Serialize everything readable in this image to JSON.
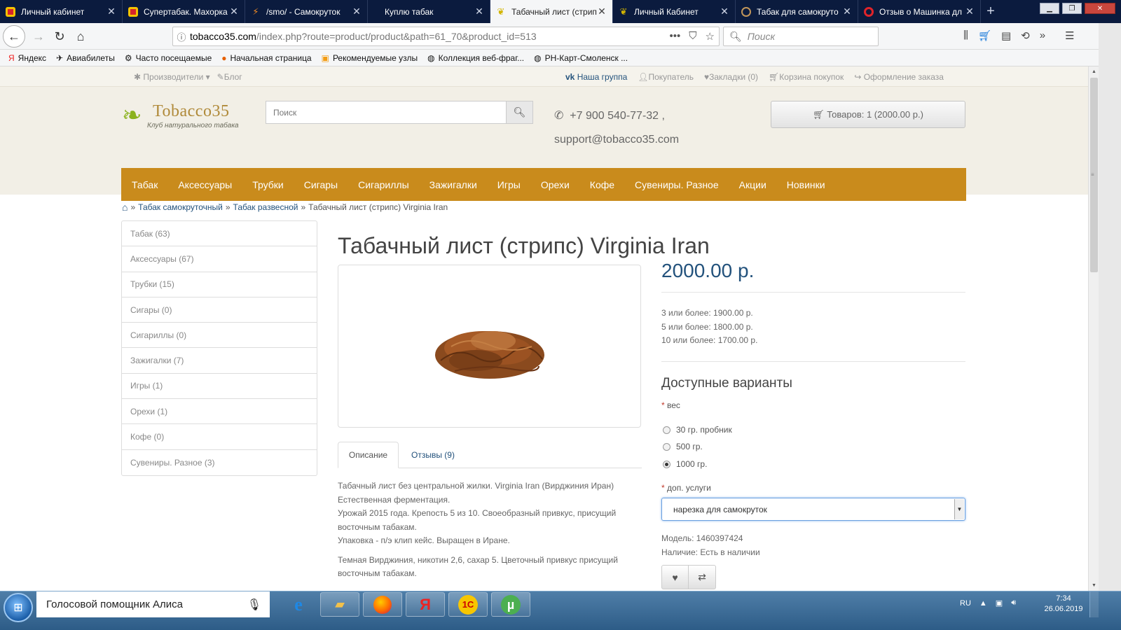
{
  "browser": {
    "tabs": [
      {
        "title": "Личный кабинет",
        "icon": "red-square-icon",
        "active": false
      },
      {
        "title": "Супертабак. Махорка",
        "icon": "red-square-icon",
        "active": false
      },
      {
        "title": "/smo/ - Самокруток",
        "icon": "bolt-icon",
        "active": false
      },
      {
        "title": "Куплю табак",
        "icon": "none",
        "active": false
      },
      {
        "title": "Табачный лист (стрип",
        "icon": "leaf-icon",
        "active": true
      },
      {
        "title": "Личный Кабинет",
        "icon": "leaf-icon",
        "active": false
      },
      {
        "title": "Табак для самокрутo",
        "icon": "ring-icon",
        "active": false
      },
      {
        "title": "Отзыв о Машинка дл",
        "icon": "opera-icon",
        "active": false
      }
    ],
    "url_domain": "tobacco35.com",
    "url_rest": "/index.php?route=product/product&path=61_70&product_id=513",
    "search_placeholder": "Поиск",
    "bookmarks": [
      {
        "label": "Яндекс",
        "icon": "yandex-icon"
      },
      {
        "label": "Авиабилеты",
        "icon": "plane-icon"
      },
      {
        "label": "Часто посещаемые",
        "icon": "gear-icon"
      },
      {
        "label": "Начальная страница",
        "icon": "firefox-icon"
      },
      {
        "label": "Рекомендуемые узлы",
        "icon": "rss-icon"
      },
      {
        "label": "Коллекция веб-фраг...",
        "icon": "globe-icon"
      },
      {
        "label": "РН-Карт-Смоленск ...",
        "icon": "globe-icon"
      }
    ]
  },
  "site": {
    "top_left": [
      "Производители",
      "Блог"
    ],
    "top_right": [
      "Наша группа",
      "Покупатель",
      "Закладки (0)",
      "Корзина покупок",
      "Оформление заказа"
    ],
    "logo_name": "Tobacco35",
    "logo_sub": "Клуб натурального табака",
    "search_placeholder": "Поиск",
    "phone": "+7 900 540-77-32 ,",
    "email": "support@tobacco35.com",
    "cart_label": "Товаров: 1 (2000.00 р.)",
    "menu": [
      "Табак",
      "Аксессуары",
      "Трубки",
      "Сигары",
      "Сигариллы",
      "Зажигалки",
      "Игры",
      "Орехи",
      "Кофе",
      "Сувениры. Разное",
      "Акции",
      "Новинки"
    ],
    "breadcrumbs": [
      "Табак самокруточный",
      "Табак развесной"
    ],
    "breadcrumb_current": "Табачный лист (стрипс) Virginia Iran",
    "sidebar": [
      "Табак (63)",
      "Аксессуары (67)",
      "Трубки (15)",
      "Сигары (0)",
      "Сигариллы (0)",
      "Зажигалки (7)",
      "Игры (1)",
      "Орехи (1)",
      "Кофе (0)",
      "Сувениры. Разное (3)"
    ]
  },
  "product": {
    "title": "Табачный лист (стрипс) Virginia Iran",
    "price": "2000.00 р.",
    "discounts": [
      "3 или более: 1900.00 р.",
      "5 или более: 1800.00 р.",
      "10 или более: 1700.00 р."
    ],
    "tab_description": "Описание",
    "tab_reviews": "Отзывы (9)",
    "description_p1": [
      "Табачный лист без центральной жилки. Virginia Iran (Вирджиния Иран)",
      "Естественная ферментация.",
      "Урожай 2015 года. Крепость 5 из 10. Своеобразный привкус, присущий",
      "восточным табакам.",
      "Упаковка - п/э клип кейс. Выращен в Иране."
    ],
    "description_p2": [
      "Темная Вирджиния, никотин 2,6, сахар 5. Цветочный привкус присущий",
      "восточным табакам."
    ],
    "variants_heading": "Доступные варианты",
    "weight_label": "вес",
    "weight_options": [
      "30 гр. пробник",
      "500 гр.",
      "1000 гр."
    ],
    "weight_selected": "1000 гр.",
    "services_label": "доп. услуги",
    "services_value": "нарезка для самокруток",
    "model": "Модель: 1460397424",
    "availability": "Наличие: Есть в наличии"
  },
  "taskbar": {
    "assistant_label": "Голосовой помощник Алиса",
    "apps": [
      "internet-explorer-icon",
      "file-explorer-icon",
      "firefox-icon",
      "yandex-browser-icon",
      "1c-icon",
      "utorrent-icon"
    ],
    "lang": "RU",
    "time": "7:34",
    "date": "26.06.2019"
  }
}
